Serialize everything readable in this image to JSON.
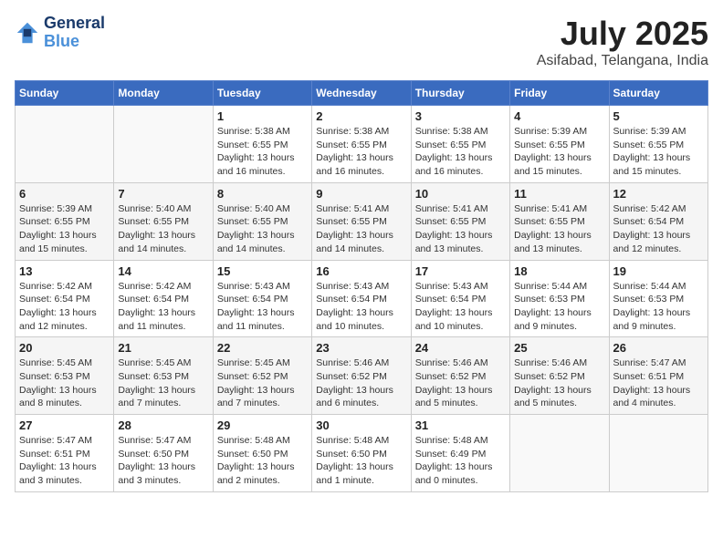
{
  "header": {
    "logo_line1": "General",
    "logo_line2": "Blue",
    "month": "July 2025",
    "location": "Asifabad, Telangana, India"
  },
  "weekdays": [
    "Sunday",
    "Monday",
    "Tuesday",
    "Wednesday",
    "Thursday",
    "Friday",
    "Saturday"
  ],
  "weeks": [
    [
      {
        "day": "",
        "info": ""
      },
      {
        "day": "",
        "info": ""
      },
      {
        "day": "1",
        "info": "Sunrise: 5:38 AM\nSunset: 6:55 PM\nDaylight: 13 hours and 16 minutes."
      },
      {
        "day": "2",
        "info": "Sunrise: 5:38 AM\nSunset: 6:55 PM\nDaylight: 13 hours and 16 minutes."
      },
      {
        "day": "3",
        "info": "Sunrise: 5:38 AM\nSunset: 6:55 PM\nDaylight: 13 hours and 16 minutes."
      },
      {
        "day": "4",
        "info": "Sunrise: 5:39 AM\nSunset: 6:55 PM\nDaylight: 13 hours and 15 minutes."
      },
      {
        "day": "5",
        "info": "Sunrise: 5:39 AM\nSunset: 6:55 PM\nDaylight: 13 hours and 15 minutes."
      }
    ],
    [
      {
        "day": "6",
        "info": "Sunrise: 5:39 AM\nSunset: 6:55 PM\nDaylight: 13 hours and 15 minutes."
      },
      {
        "day": "7",
        "info": "Sunrise: 5:40 AM\nSunset: 6:55 PM\nDaylight: 13 hours and 14 minutes."
      },
      {
        "day": "8",
        "info": "Sunrise: 5:40 AM\nSunset: 6:55 PM\nDaylight: 13 hours and 14 minutes."
      },
      {
        "day": "9",
        "info": "Sunrise: 5:41 AM\nSunset: 6:55 PM\nDaylight: 13 hours and 14 minutes."
      },
      {
        "day": "10",
        "info": "Sunrise: 5:41 AM\nSunset: 6:55 PM\nDaylight: 13 hours and 13 minutes."
      },
      {
        "day": "11",
        "info": "Sunrise: 5:41 AM\nSunset: 6:55 PM\nDaylight: 13 hours and 13 minutes."
      },
      {
        "day": "12",
        "info": "Sunrise: 5:42 AM\nSunset: 6:54 PM\nDaylight: 13 hours and 12 minutes."
      }
    ],
    [
      {
        "day": "13",
        "info": "Sunrise: 5:42 AM\nSunset: 6:54 PM\nDaylight: 13 hours and 12 minutes."
      },
      {
        "day": "14",
        "info": "Sunrise: 5:42 AM\nSunset: 6:54 PM\nDaylight: 13 hours and 11 minutes."
      },
      {
        "day": "15",
        "info": "Sunrise: 5:43 AM\nSunset: 6:54 PM\nDaylight: 13 hours and 11 minutes."
      },
      {
        "day": "16",
        "info": "Sunrise: 5:43 AM\nSunset: 6:54 PM\nDaylight: 13 hours and 10 minutes."
      },
      {
        "day": "17",
        "info": "Sunrise: 5:43 AM\nSunset: 6:54 PM\nDaylight: 13 hours and 10 minutes."
      },
      {
        "day": "18",
        "info": "Sunrise: 5:44 AM\nSunset: 6:53 PM\nDaylight: 13 hours and 9 minutes."
      },
      {
        "day": "19",
        "info": "Sunrise: 5:44 AM\nSunset: 6:53 PM\nDaylight: 13 hours and 9 minutes."
      }
    ],
    [
      {
        "day": "20",
        "info": "Sunrise: 5:45 AM\nSunset: 6:53 PM\nDaylight: 13 hours and 8 minutes."
      },
      {
        "day": "21",
        "info": "Sunrise: 5:45 AM\nSunset: 6:53 PM\nDaylight: 13 hours and 7 minutes."
      },
      {
        "day": "22",
        "info": "Sunrise: 5:45 AM\nSunset: 6:52 PM\nDaylight: 13 hours and 7 minutes."
      },
      {
        "day": "23",
        "info": "Sunrise: 5:46 AM\nSunset: 6:52 PM\nDaylight: 13 hours and 6 minutes."
      },
      {
        "day": "24",
        "info": "Sunrise: 5:46 AM\nSunset: 6:52 PM\nDaylight: 13 hours and 5 minutes."
      },
      {
        "day": "25",
        "info": "Sunrise: 5:46 AM\nSunset: 6:52 PM\nDaylight: 13 hours and 5 minutes."
      },
      {
        "day": "26",
        "info": "Sunrise: 5:47 AM\nSunset: 6:51 PM\nDaylight: 13 hours and 4 minutes."
      }
    ],
    [
      {
        "day": "27",
        "info": "Sunrise: 5:47 AM\nSunset: 6:51 PM\nDaylight: 13 hours and 3 minutes."
      },
      {
        "day": "28",
        "info": "Sunrise: 5:47 AM\nSunset: 6:50 PM\nDaylight: 13 hours and 3 minutes."
      },
      {
        "day": "29",
        "info": "Sunrise: 5:48 AM\nSunset: 6:50 PM\nDaylight: 13 hours and 2 minutes."
      },
      {
        "day": "30",
        "info": "Sunrise: 5:48 AM\nSunset: 6:50 PM\nDaylight: 13 hours and 1 minute."
      },
      {
        "day": "31",
        "info": "Sunrise: 5:48 AM\nSunset: 6:49 PM\nDaylight: 13 hours and 0 minutes."
      },
      {
        "day": "",
        "info": ""
      },
      {
        "day": "",
        "info": ""
      }
    ]
  ]
}
